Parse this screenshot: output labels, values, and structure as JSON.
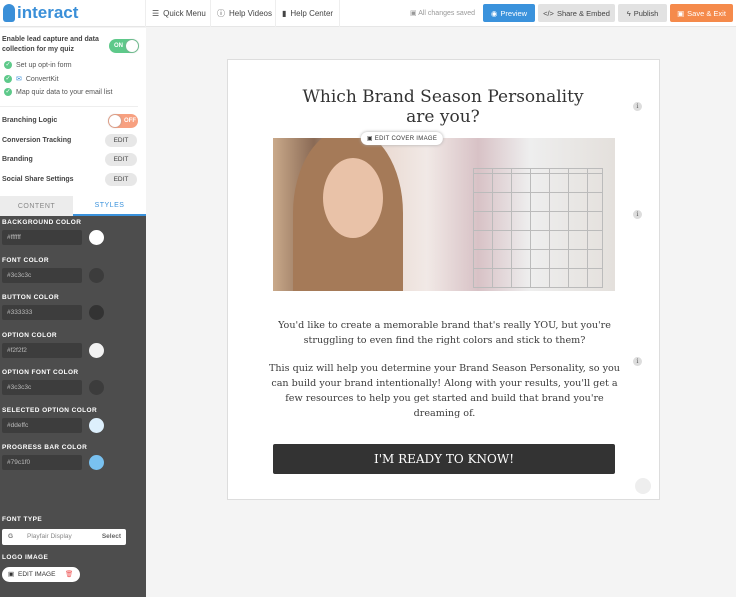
{
  "app": {
    "logo": "interact"
  },
  "nav": {
    "quick_menu": "Quick Menu",
    "help_videos": "Help Videos",
    "help_center": "Help Center"
  },
  "toolbar": {
    "saved": "All changes saved",
    "preview": "Preview",
    "share": "Share & Embed",
    "publish": "Publish",
    "save_exit": "Save & Exit"
  },
  "sidebar": {
    "lead_label": "Enable lead capture and data collection for my quiz",
    "lead_toggle": "ON",
    "checks": [
      "Set up opt-in form",
      "ConvertKit",
      "Map quiz data to your email list"
    ],
    "branching": "Branching Logic",
    "branching_toggle": "OFF",
    "conversion": "Conversion Tracking",
    "branding": "Branding",
    "social": "Social Share Settings",
    "edit": "EDIT",
    "tabs": [
      "CONTENT",
      "STYLES"
    ]
  },
  "styles": {
    "colors": [
      {
        "label": "BACKGROUND COLOR",
        "value": "#ffffff"
      },
      {
        "label": "FONT COLOR",
        "value": "#3c3c3c"
      },
      {
        "label": "BUTTON COLOR",
        "value": "#333333"
      },
      {
        "label": "OPTION COLOR",
        "value": "#f2f2f2"
      },
      {
        "label": "OPTION FONT COLOR",
        "value": "#3c3c3c"
      },
      {
        "label": "SELECTED OPTION COLOR",
        "value": "#ddeffc"
      },
      {
        "label": "PROGRESS BAR COLOR",
        "value": "#79c1f0"
      }
    ],
    "font_type_label": "FONT TYPE",
    "font": "Playfair Display",
    "font_select": "Select",
    "logo_label": "LOGO IMAGE",
    "edit_image": "EDIT IMAGE"
  },
  "quiz": {
    "title": "Which Brand Season Personality are you?",
    "edit_cover": "EDIT COVER IMAGE",
    "para1": "You'd like to create a memorable brand that's really YOU, but you're struggling to even find the right colors and stick to them?",
    "para2": "This quiz will help you determine your Brand Season Personality, so you can build your brand intentionally! Along with your results, you'll get a few resources to help you get started and build that brand you're dreaming of.",
    "cta": "I'M READY TO KNOW!"
  }
}
